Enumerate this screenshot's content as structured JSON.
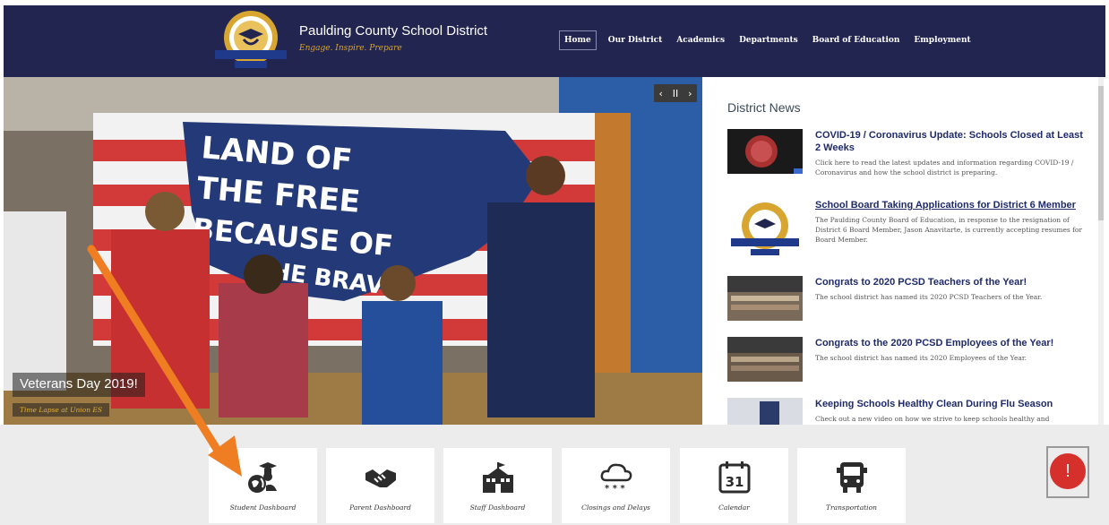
{
  "header": {
    "title": "Paulding County School District",
    "tagline": "Engage. Inspire. Prepare",
    "nav": [
      "Home",
      "Our District",
      "Academics",
      "Departments",
      "Board of Education",
      "Employment"
    ],
    "active_nav": "Home",
    "bg_color": "#232551",
    "accent_color": "#d8a531"
  },
  "slider": {
    "controls": {
      "prev": "‹",
      "pause": "II",
      "next": "›"
    },
    "caption_title": "Veterans Day 2019!",
    "caption_sub": "Time Lapse at Union ES",
    "banner_text": [
      "LAND OF",
      "THE FREE",
      "BECAUSE OF",
      "THE BRAVE"
    ]
  },
  "news": {
    "heading": "District News",
    "items": [
      {
        "title": "COVID-19 / Coronavirus Update: Schools Closed at Least 2 Weeks",
        "desc": "Click here to read the latest updates and information regarding COVID-19 / Coronavirus and how the school district is preparing.",
        "thumb": "virus-image"
      },
      {
        "title": "School Board Taking Applications for District 6 Member",
        "desc": "The Paulding County Board of Education, in response to the resignation of District 6 Board Member, Jason Anavitarte, is currently accepting resumes for Board Member.",
        "thumb": "district-seal"
      },
      {
        "title": "Congrats to 2020 PCSD Teachers of the Year!",
        "desc": "The school district has named its 2020 PCSD Teachers of the Year.",
        "thumb": "group-photo"
      },
      {
        "title": "Congrats to the 2020 PCSD Employees of the Year!",
        "desc": "The school district has named its 2020 Employees of the Year.",
        "thumb": "group-photo"
      },
      {
        "title": "Keeping Schools Healthy Clean During Flu Season",
        "desc": "Check out a new video on how we strive to keep schools healthy and",
        "thumb": "cleaning-photo"
      }
    ]
  },
  "quick_links": [
    {
      "label": "Student Dashboard",
      "icon": "student-globe-icon"
    },
    {
      "label": "Parent Dashboard",
      "icon": "handshake-icon"
    },
    {
      "label": "Staff Dashboard",
      "icon": "school-building-icon"
    },
    {
      "label": "Closings and Delays",
      "icon": "snow-cloud-icon"
    },
    {
      "label": "Calendar",
      "icon": "calendar-icon",
      "day": "31"
    },
    {
      "label": "Transportation",
      "icon": "school-bus-icon"
    }
  ],
  "alert": {
    "symbol": "!",
    "color": "#d6302c"
  },
  "annotation": {
    "arrow_color": "#ef7d22"
  }
}
